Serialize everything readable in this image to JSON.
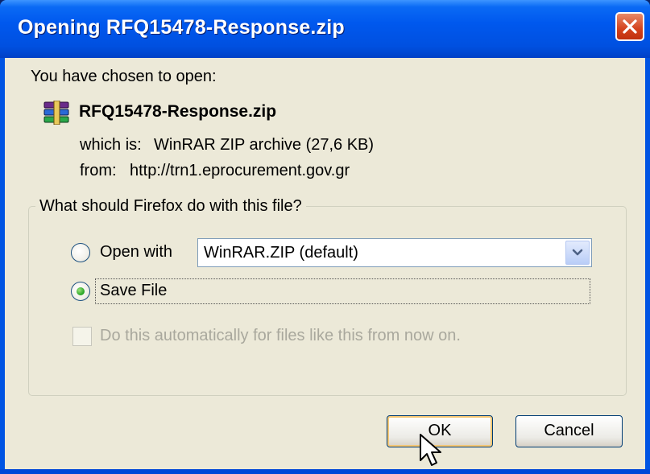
{
  "window": {
    "title": "Opening RFQ15478-Response.zip"
  },
  "intro": "You have chosen to open:",
  "file": {
    "name": "RFQ15478-Response.zip",
    "icon": "winrar-archive-icon",
    "type_label": "which is:",
    "type_value": "WinRAR ZIP archive (27,6 KB)",
    "from_label": "from:",
    "from_value": "http://trn1.eprocurement.gov.gr"
  },
  "group": {
    "legend": "What should Firefox do with this file?",
    "open_with_label": "Open with",
    "open_with_selected": false,
    "open_with_app": "WinRAR.ZIP (default)",
    "save_file_label": "Save File",
    "save_file_selected": true,
    "auto_label": "Do this automatically for files like this from now on.",
    "auto_checked": false,
    "auto_enabled": false
  },
  "buttons": {
    "ok": "OK",
    "cancel": "Cancel"
  },
  "colors": {
    "titlebar": "#0058ee",
    "face": "#ece9d8",
    "close": "#d4421c"
  }
}
